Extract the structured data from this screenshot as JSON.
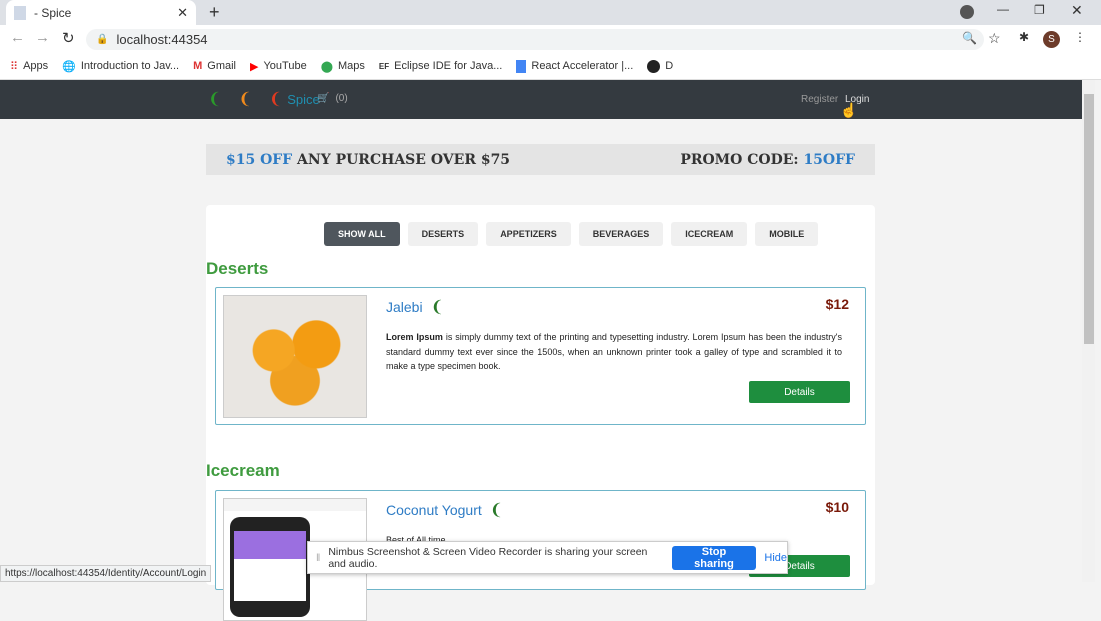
{
  "browser": {
    "tab_title": "- Spice",
    "url": "localhost:44354",
    "bookmarks": [
      "Apps",
      "Introduction to Jav...",
      "Gmail",
      "YouTube",
      "Maps",
      "Eclipse IDE for Java...",
      "React Accelerator |...",
      "D"
    ],
    "profile_initial": "S",
    "status_url": "https://localhost:44354/Identity/Account/Login"
  },
  "nav": {
    "brand": "Spice",
    "cart_count": "(0)",
    "register": "Register",
    "login": "Login"
  },
  "promo": {
    "left_highlight": "$15 OFF",
    "left_text": " ANY PURCHASE OVER $75",
    "right_text": "PROMO CODE: ",
    "right_highlight": "15OFF"
  },
  "filters": [
    "SHOW ALL",
    "DESERTS",
    "APPETIZERS",
    "BEVERAGES",
    "ICECREAM",
    "MOBILE"
  ],
  "sections": [
    {
      "category": "Deserts",
      "item": {
        "name": "Jalebi",
        "price": "$12",
        "desc_bold": "Lorem Ipsum",
        "desc": " is simply dummy text of the printing and typesetting industry. Lorem Ipsum has been the industry's standard dummy text ever since the 1500s, when an unknown printer took a galley of type and scrambled it to make a type specimen book.",
        "button": "Details"
      }
    },
    {
      "category": "Icecream",
      "item": {
        "name": "Coconut Yogurt",
        "price": "$10",
        "desc": "Best of All time",
        "button": "Details"
      }
    }
  ],
  "nimbus": {
    "message": "Nimbus Screenshot & Screen Video Recorder is sharing your screen and audio.",
    "stop": "Stop sharing",
    "hide": "Hide"
  },
  "colors": {
    "nav": "#343a40",
    "accent_green": "#1e8e3e",
    "link_blue": "#2e7cc5"
  }
}
